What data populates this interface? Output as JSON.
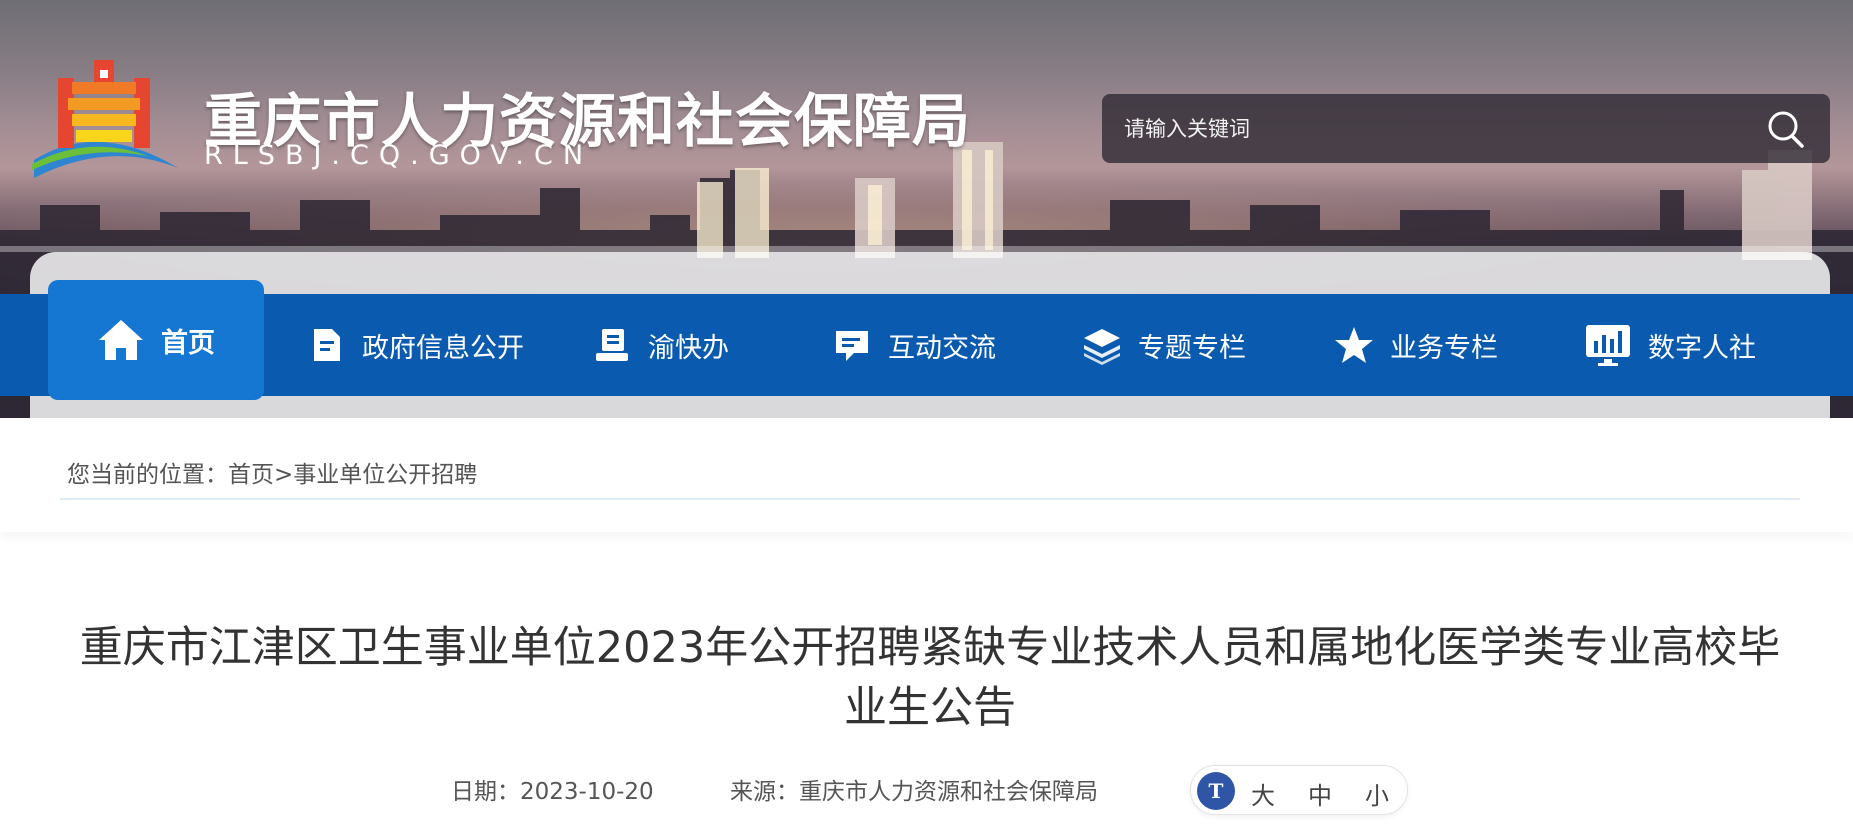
{
  "header": {
    "site_title": "重庆市人力资源和社会保障局",
    "site_domain": "RLSBJ.CQ.GOV.CN",
    "logo_icon": "temple-gate-logo"
  },
  "search": {
    "placeholder": "请输入关键词",
    "button_icon": "search-icon"
  },
  "nav": {
    "items": [
      {
        "label": "首页",
        "icon": "home-icon",
        "active": true
      },
      {
        "label": "政府信息公开",
        "icon": "document-icon"
      },
      {
        "label": "渝快办",
        "icon": "service-desk-icon"
      },
      {
        "label": "互动交流",
        "icon": "chat-icon"
      },
      {
        "label": "专题专栏",
        "icon": "layers-icon"
      },
      {
        "label": "业务专栏",
        "icon": "star-icon"
      },
      {
        "label": "数字人社",
        "icon": "monitor-chart-icon"
      }
    ],
    "colors": {
      "bar": "#0a5bb0",
      "active": "#1677d2"
    }
  },
  "breadcrumb": {
    "prefix": "您当前的位置：",
    "home": "首页",
    "separator": ">",
    "current": "事业单位公开招聘"
  },
  "article": {
    "title": "重庆市江津区卫生事业单位2023年公开招聘紧缺专业技术人员和属地化医学类专业高校毕业生公告",
    "date_label": "日期：",
    "date": "2023-10-20",
    "source_label": "来源：",
    "source": "重庆市人力资源和社会保障局"
  },
  "font_size": {
    "icon_text": "T",
    "large": "大",
    "medium": "中",
    "small": "小"
  }
}
